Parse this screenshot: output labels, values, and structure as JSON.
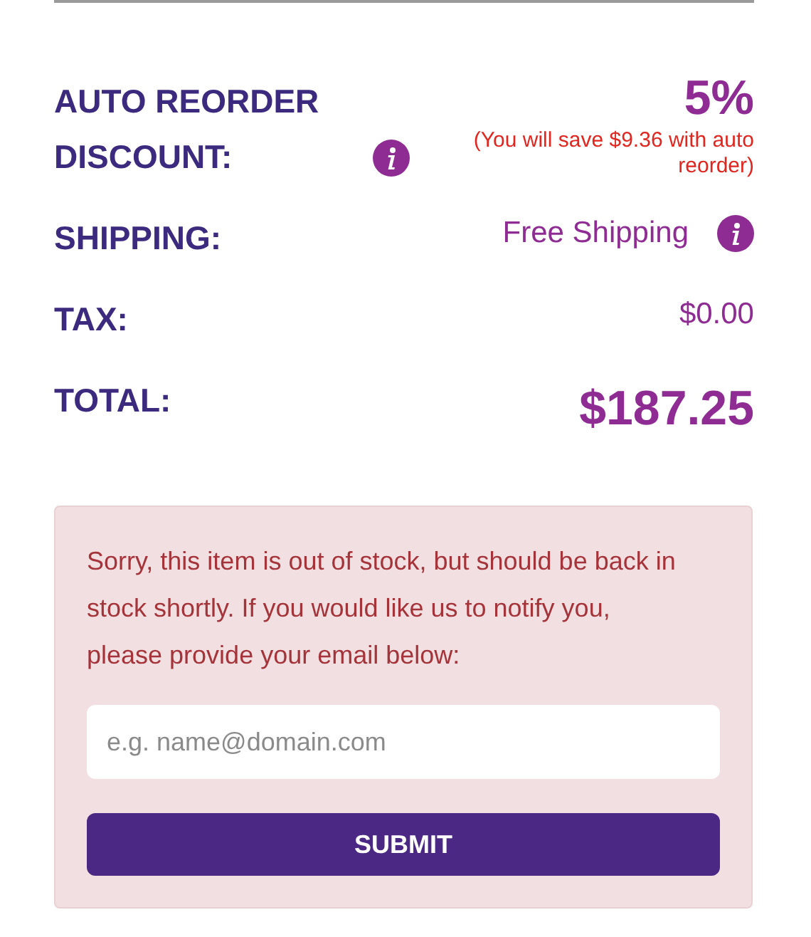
{
  "summary": [
    {
      "kind": "discount",
      "label": "AUTO REORDER DISCOUNT:",
      "info": true,
      "value": "5%",
      "note": "(You will save $9.36 with auto reorder)"
    },
    {
      "kind": "plain",
      "label": "SHIPPING:",
      "info": true,
      "value": "Free Shipping"
    },
    {
      "kind": "plain",
      "label": "TAX:",
      "info": false,
      "value": "$0.00"
    },
    {
      "kind": "total",
      "label": "TOTAL:",
      "info": false,
      "value": "$187.25"
    }
  ],
  "notice": {
    "message": "Sorry, this item is out of stock, but should be back in stock shortly. If you would like us to notify you, please provide your email below:",
    "email": {
      "placeholder": "e.g. name@domain.com"
    },
    "button": "SUBMIT"
  }
}
